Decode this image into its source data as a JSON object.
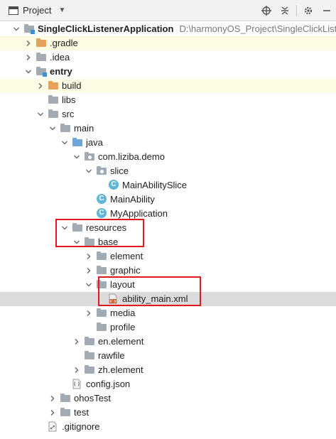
{
  "toolbar": {
    "title": "Project",
    "icons": [
      "globe-target-icon",
      "collapse-all-icon",
      "settings-gear-icon",
      "minimize-icon"
    ]
  },
  "tree": [
    {
      "label": "SingleClickListenerApplication",
      "path": "D:\\harmonyOS_Project\\SingleClickListen",
      "icon": "module-folder",
      "expanded": true,
      "bold": true
    },
    {
      "label": ".gradle",
      "icon": "folder-orange",
      "expanded": false
    },
    {
      "label": ".idea",
      "icon": "folder-grey",
      "expanded": false
    },
    {
      "label": "entry",
      "icon": "module-folder",
      "expanded": true,
      "bold": true
    },
    {
      "label": "build",
      "icon": "folder-orange",
      "expanded": false
    },
    {
      "label": "libs",
      "icon": "folder-grey"
    },
    {
      "label": "src",
      "icon": "folder-grey",
      "expanded": true
    },
    {
      "label": "main",
      "icon": "folder-grey",
      "expanded": true
    },
    {
      "label": "java",
      "icon": "source-folder",
      "expanded": true
    },
    {
      "label": "com.liziba.demo",
      "icon": "package-folder",
      "expanded": true
    },
    {
      "label": "slice",
      "icon": "package-folder",
      "expanded": true
    },
    {
      "label": "MainAbilitySlice",
      "icon": "class-icon"
    },
    {
      "label": "MainAbility",
      "icon": "class-icon"
    },
    {
      "label": "MyApplication",
      "icon": "class-icon"
    },
    {
      "label": "resources",
      "icon": "folder-grey",
      "expanded": true
    },
    {
      "label": "base",
      "icon": "folder-grey",
      "expanded": true
    },
    {
      "label": "element",
      "icon": "folder-grey",
      "expanded": false
    },
    {
      "label": "graphic",
      "icon": "folder-grey",
      "expanded": false
    },
    {
      "label": "layout",
      "icon": "folder-grey",
      "expanded": true
    },
    {
      "label": "ability_main.xml",
      "icon": "xml-file-icon",
      "selected": true
    },
    {
      "label": "media",
      "icon": "folder-grey",
      "expanded": false
    },
    {
      "label": "profile",
      "icon": "folder-grey"
    },
    {
      "label": "en.element",
      "icon": "folder-grey",
      "expanded": false
    },
    {
      "label": "rawfile",
      "icon": "folder-grey"
    },
    {
      "label": "zh.element",
      "icon": "folder-grey",
      "expanded": false
    },
    {
      "label": "config.json",
      "icon": "json-file-icon"
    },
    {
      "label": "ohosTest",
      "icon": "folder-grey",
      "expanded": false
    },
    {
      "label": "test",
      "icon": "folder-grey",
      "expanded": false
    },
    {
      "label": ".gitignore",
      "icon": "gitignore-file-icon"
    }
  ],
  "colors": {
    "highlight_row": "#fdfbe3",
    "selected_row": "#dcdcdc",
    "annotation_box": "#e0191e",
    "folder_grey": "#a2aab4",
    "folder_orange": "#e8a15a",
    "class_icon": "#5fb6d9"
  }
}
